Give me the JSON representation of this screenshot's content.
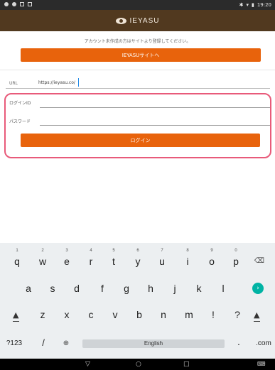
{
  "status_bar": {
    "time": "19:20",
    "icons": [
      "notification-icon",
      "notification-icon",
      "screenshot-icon",
      "sd-card-icon",
      "bluetooth-icon",
      "wifi-icon",
      "battery-icon"
    ]
  },
  "app_header": {
    "logo_text": "IEYASU"
  },
  "signup": {
    "note": "アカウント未作成の方はサイトより登録してください。",
    "button_label": "IEYASUサイトへ"
  },
  "url_field": {
    "label": "URL",
    "value": "https://ieyasu.co/"
  },
  "login_form": {
    "login_id_label": "ログインID",
    "password_label": "パスワード",
    "login_button_label": "ログイン"
  },
  "keyboard": {
    "row1": [
      {
        "ch": "q",
        "num": "1"
      },
      {
        "ch": "w",
        "num": "2"
      },
      {
        "ch": "e",
        "num": "3"
      },
      {
        "ch": "r",
        "num": "4"
      },
      {
        "ch": "t",
        "num": "5"
      },
      {
        "ch": "y",
        "num": "6"
      },
      {
        "ch": "u",
        "num": "7"
      },
      {
        "ch": "i",
        "num": "8"
      },
      {
        "ch": "o",
        "num": "9"
      },
      {
        "ch": "p",
        "num": "0"
      }
    ],
    "row2": [
      "a",
      "s",
      "d",
      "f",
      "g",
      "h",
      "j",
      "k",
      "l"
    ],
    "row3": [
      "z",
      "x",
      "c",
      "v",
      "b",
      "n",
      "m",
      "!",
      "?"
    ],
    "symbols_key": "?123",
    "slash_key": "/",
    "space_label": "English",
    "period_key": ".",
    "com_key": ".com"
  },
  "colors": {
    "header_brown": "#51391f",
    "accent_orange": "#e8630c",
    "highlight_pink": "#e85a7a",
    "go_teal": "#00b3a4"
  }
}
